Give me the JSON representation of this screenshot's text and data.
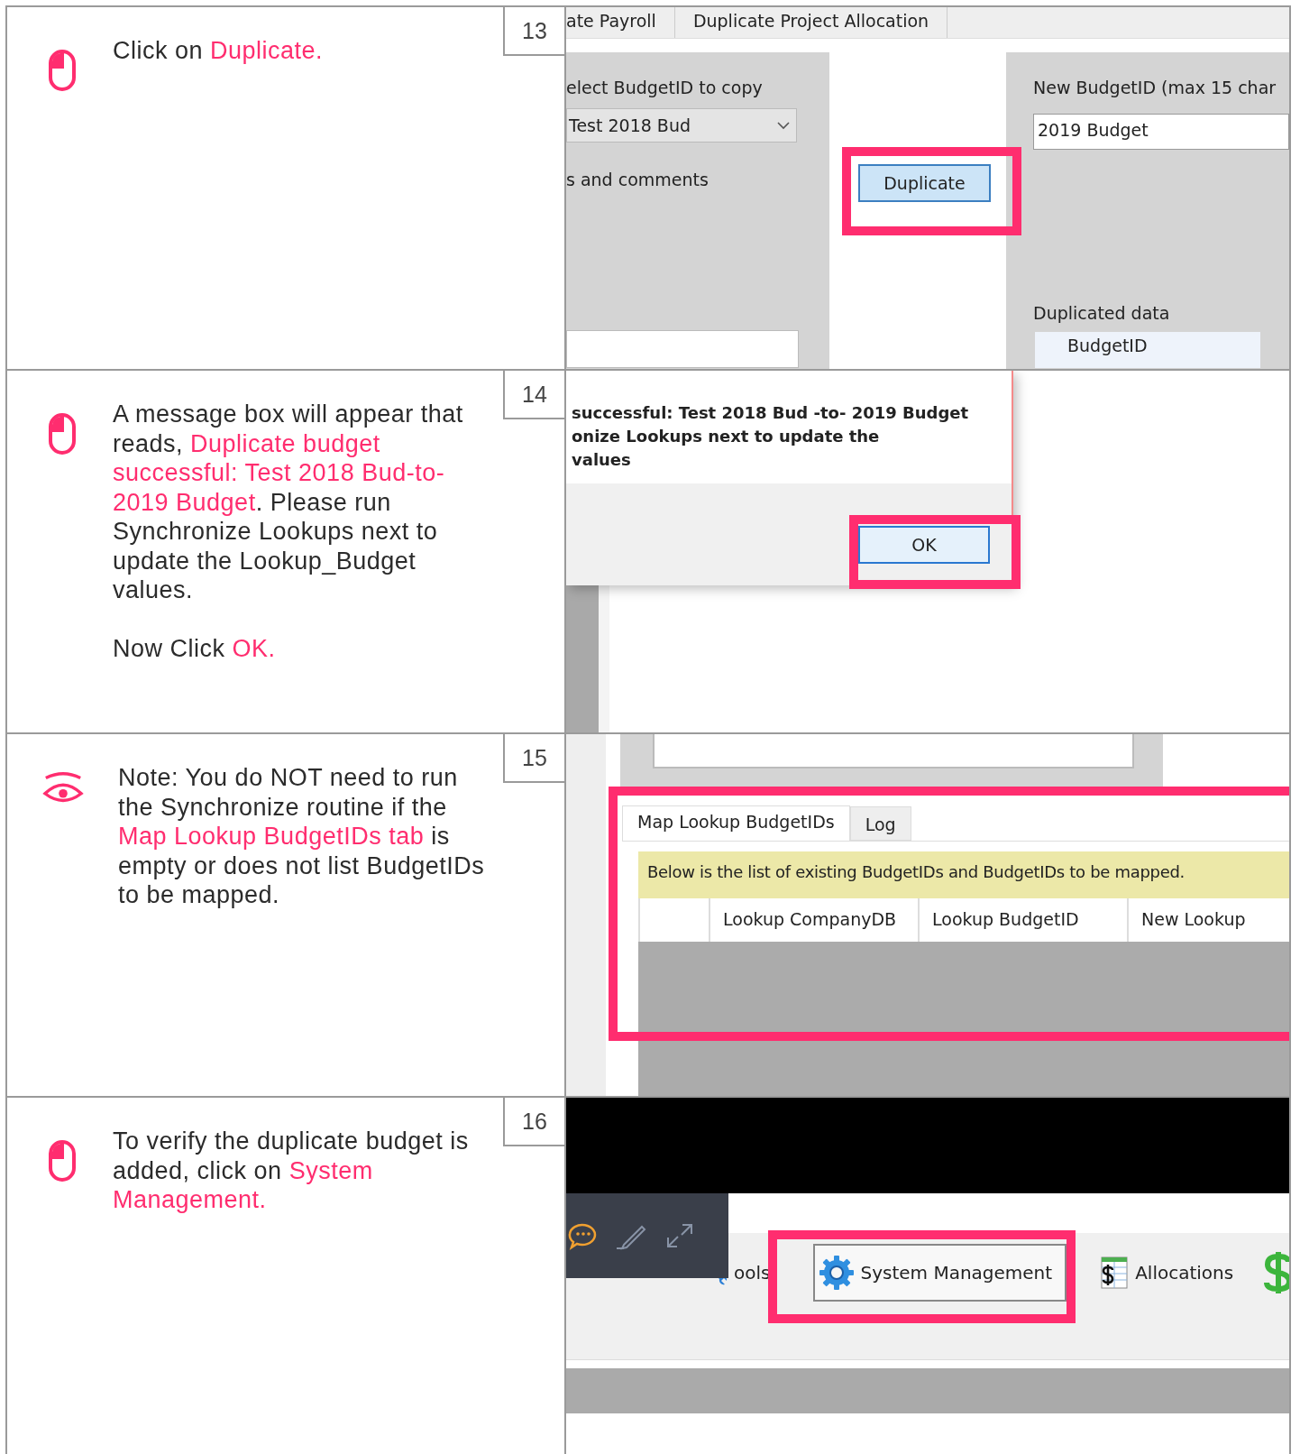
{
  "steps": [
    {
      "number": "13",
      "kind": "click",
      "paragraphs": [
        [
          {
            "text": "Click on ",
            "highlight": false
          },
          {
            "text": "Duplicate.",
            "highlight": true
          }
        ]
      ],
      "screenshot": {
        "kind": "duplicate_form",
        "tabs": [
          "ate Payroll",
          "Duplicate Project Allocation"
        ],
        "select_label": "elect BudgetID to copy",
        "select_value": "Test 2018 Bud",
        "comments_label": "s and comments",
        "button": "Duplicate",
        "new_label": "New BudgetID (max 15 char",
        "new_value": "2019 Budget",
        "data_label": "Duplicated data",
        "grid_header": "BudgetID"
      }
    },
    {
      "number": "14",
      "kind": "click",
      "paragraphs": [
        [
          {
            "text": "A message box will appear that reads, ",
            "highlight": false
          },
          {
            "text": "Duplicate budget successful: Test 2018 Bud-to-2019 Budget",
            "highlight": true
          },
          {
            "text": ". Please run Synchronize Lookups next to update the Lookup_Budget values.",
            "highlight": false
          }
        ],
        [
          {
            "text": "Now Click ",
            "highlight": false
          },
          {
            "text": "OK.",
            "highlight": true
          }
        ]
      ],
      "screenshot": {
        "kind": "message_box",
        "lines": [
          "successful: Test 2018 Bud -to- 2019 Budget",
          "onize Lookups next to update the",
          "values"
        ],
        "button": "OK"
      }
    },
    {
      "number": "15",
      "kind": "note",
      "paragraphs": [
        [
          {
            "text": "Note: You do NOT need to run the Synchronize routine if the ",
            "highlight": false
          },
          {
            "text": "Map Lookup BudgetIDs tab",
            "highlight": true
          },
          {
            "text": " is empty or does not list BudgetIDs to be mapped.",
            "highlight": false
          }
        ]
      ],
      "screenshot": {
        "kind": "lookup_tabs",
        "tabs": [
          {
            "label": "Map Lookup BudgetIDs",
            "selected": true
          },
          {
            "label": "Log",
            "selected": false
          }
        ],
        "notice": "Below is the list of existing BudgetIDs and BudgetIDs to be mapped.",
        "columns": [
          "Lookup CompanyDB",
          "Lookup BudgetID",
          "New Lookup"
        ]
      }
    },
    {
      "number": "16",
      "kind": "click",
      "paragraphs": [
        [
          {
            "text": "To verify the duplicate budget is added, click on ",
            "highlight": false
          },
          {
            "text": "System Management.",
            "highlight": true
          }
        ]
      ],
      "screenshot": {
        "kind": "toolbar",
        "items": [
          {
            "label": "ools",
            "highlighted": false
          },
          {
            "label": "System Management",
            "highlighted": true
          },
          {
            "label": "Allocations",
            "highlighted": false
          }
        ]
      }
    }
  ]
}
